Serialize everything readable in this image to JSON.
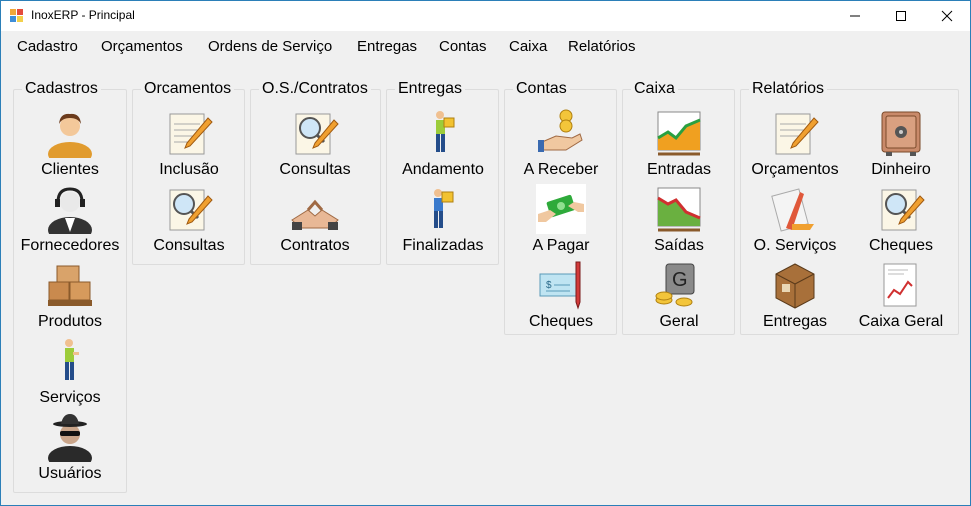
{
  "window": {
    "title": "InoxERP - Principal"
  },
  "menu": [
    "Cadastro",
    "Orçamentos",
    "Ordens de Serviço",
    "Entregas",
    "Contas",
    "Caixa",
    "Relatórios"
  ],
  "groups": {
    "cadastros": {
      "title": "Cadastros",
      "items": [
        "Clientes",
        "Fornecedores",
        "Produtos",
        "Serviços",
        "Usuários"
      ]
    },
    "orcamentos": {
      "title": "Orcamentos",
      "items": [
        "Inclusão",
        "Consultas"
      ]
    },
    "contratos": {
      "title": "O.S./Contratos",
      "items": [
        "Consultas",
        "Contratos"
      ]
    },
    "entregas": {
      "title": "Entregas",
      "items": [
        "Andamento",
        "Finalizadas"
      ]
    },
    "contas": {
      "title": "Contas",
      "items": [
        "A Receber",
        "A Pagar",
        "Cheques"
      ]
    },
    "caixa": {
      "title": "Caixa",
      "items": [
        "Entradas",
        "Saídas",
        "Geral"
      ]
    },
    "relatorios": {
      "title": "Relatórios",
      "items": [
        "Orçamentos",
        "Dinheiro",
        "O. Serviços",
        "Cheques",
        "Entregas",
        "Caixa Geral"
      ]
    }
  }
}
